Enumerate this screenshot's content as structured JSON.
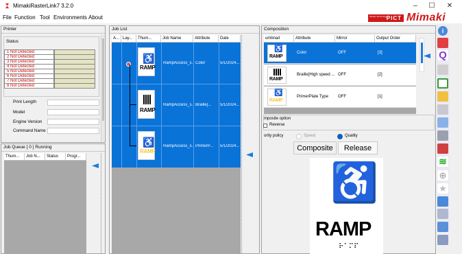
{
  "window": {
    "title": "MimakiRasterLink7 3.2.0"
  },
  "menu": [
    "File",
    "Function",
    "Tool",
    "Environments",
    "About"
  ],
  "logos": {
    "pict_small": "Mimaki Technology",
    "pict": "PICT",
    "mimaki": "Mimaki"
  },
  "printer": {
    "panel_title": "Printer",
    "status_label": "Status",
    "status_rows": [
      "1 Not Detected",
      "2 Not Detected",
      "3 Not Detected",
      "4 Not Detected",
      "5 Not Detected",
      "6 Not Detected",
      "7 Not Detected",
      "8 Not Detected"
    ],
    "fields": [
      {
        "label": "Print Length",
        "value": ""
      },
      {
        "label": "Model",
        "value": ""
      },
      {
        "label": "Engine Version",
        "value": ""
      },
      {
        "label": "Command Name",
        "value": ""
      }
    ]
  },
  "job_queue": {
    "title": "Job Queue [ 0 ] Running",
    "columns": [
      "Thum...",
      "Job N...",
      "Status",
      "Progr..."
    ]
  },
  "job_list": {
    "title": "Job List",
    "columns": [
      "A...",
      "Lay...",
      "Thum...",
      "Job Name",
      "Attribute",
      "Date"
    ],
    "rows": [
      {
        "name": "RampAccess_s...",
        "attribute": "Color",
        "date": "5/1/2024..."
      },
      {
        "name": "RampAccess_s...",
        "attribute": "Braille[...",
        "date": "5/1/2024..."
      },
      {
        "name": "RampAccess_s...",
        "attribute": "PrimerP...",
        "date": "5/1/2024..."
      }
    ]
  },
  "composition": {
    "title": "Composition",
    "columns": [
      "umbnail",
      "Attribute",
      "Mirror",
      "Output Order"
    ],
    "rows": [
      {
        "attribute": "Color",
        "mirror": "OFF",
        "order": "[3]"
      },
      {
        "attribute": "Braille[High speed ...",
        "mirror": "OFF",
        "order": "[2]"
      },
      {
        "attribute": "PrimerPlate Type",
        "mirror": "OFF",
        "order": "[1]"
      }
    ],
    "option_label": "mposite option",
    "reverse_label": "Reverse",
    "policy_label": "ority policy",
    "speed_label": "Speed",
    "quality_label": "Quality",
    "composite_btn": "Composite",
    "release_btn": "Release"
  },
  "preview": {
    "word": "RAMP",
    "braille": "⠗⠁⠍⠏"
  },
  "thumb_word": "RAMP",
  "colors": {
    "selection": "#0a73d8",
    "accent": "#d01818"
  }
}
